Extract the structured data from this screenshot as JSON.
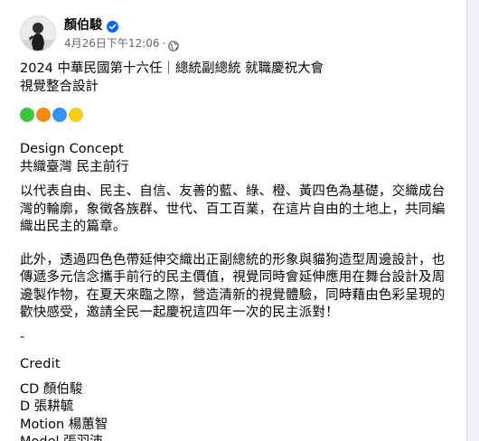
{
  "post": {
    "author": "顏伯駿",
    "timestamp": "4月26日下午12:06",
    "separator": "·",
    "title_lines": [
      "2024 中華民國第十六任｜總統副總統 就職慶祝大會",
      "視覺整合設計"
    ],
    "color_dots": [
      {
        "icon": "green-circle-emoji",
        "color": "#3ec43e"
      },
      {
        "icon": "orange-circle-emoji",
        "color": "#f7890e"
      },
      {
        "icon": "blue-circle-emoji",
        "color": "#3a8ff2"
      },
      {
        "icon": "yellow-circle-emoji",
        "color": "#f5cf18"
      }
    ],
    "concept_lines": [
      "Design Concept",
      "共織臺灣 民主前行"
    ],
    "paragraph1": "以代表自由、民主、自信、友善的藍、綠、橙、黃四色為基礎，交織成台灣的輪廓，象徵各族群、世代、百工百業，在這片自由的土地上，共同編織出民主的篇章。",
    "paragraph2": "此外，透過四色色帶延伸交織出正副總統的形象與貓狗造型周邊設計，也傳遞多元信念攜手前行的民主價值，視覺同時會延伸應用在舞台設計及周邊製作物，在夏天來臨之際，營造清新的視覺體驗，同時藉由色彩呈現的歡快感受，邀請全民一起慶祝這四年一次的民主派對！",
    "dash": "-",
    "credit_title": "Credit",
    "credits": [
      "CD 顏伯駿",
      "D 張耕毓",
      "Motion 楊蕙智",
      "Model 張羽沛"
    ]
  },
  "colors": {
    "verified_badge": "#0866ff",
    "meta_text": "#65676b",
    "card_background": "#ffffff",
    "page_background": "#f0f2f5"
  }
}
